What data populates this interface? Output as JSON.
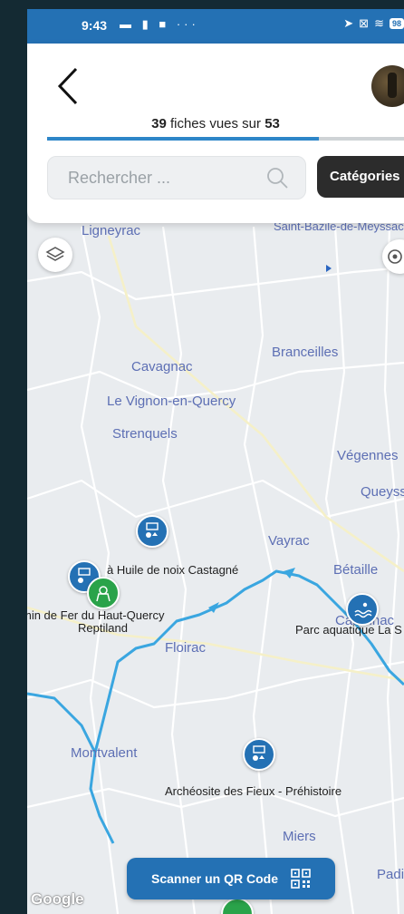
{
  "status_bar": {
    "time": "9:43",
    "battery": "98"
  },
  "header": {
    "progress": {
      "seen": "39",
      "middle": " fiches vues sur ",
      "total": "53",
      "fraction": 0.736
    },
    "search": {
      "placeholder": "Rechercher ..."
    },
    "categories_label": "Catégories"
  },
  "map": {
    "places": [
      "Ligneyrac",
      "Saint-Bazile-de-Meyssac",
      "Branceilles",
      "Cavagnac",
      "Le Vignon-en-Quercy",
      "Strenquels",
      "Végennes",
      "Queyssac",
      "Vayrac",
      "Bétaille",
      "Floirac",
      "Carennac",
      "Montvalent",
      "Miers",
      "Padirac"
    ],
    "poi_labels": [
      "à Huile de noix Castagné",
      "min de Fer du Haut-Quercy",
      "Reptiland",
      "Parc aquatique La S",
      "Archéosite des Fieux - Préhistoire"
    ]
  },
  "qr_button_label": "Scanner un QR Code",
  "google_logo": "Google",
  "colors": {
    "accent": "#2471b4",
    "map_bg": "#e9ecef",
    "river": "#3aa6e0",
    "green_marker": "#2aa34a"
  }
}
